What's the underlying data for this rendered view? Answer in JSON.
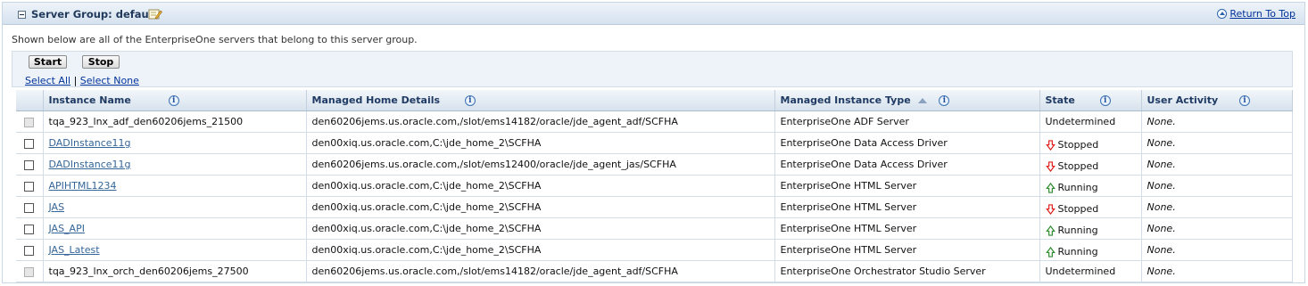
{
  "header": {
    "title": "Server Group: default",
    "return_to_top": "Return To Top"
  },
  "description": "Shown below are all of the EnterpriseOne servers that belong to this server group.",
  "toolbar": {
    "start_label": "Start",
    "stop_label": "Stop",
    "select_all": "Select All",
    "separator": "|",
    "select_none": "Select None"
  },
  "table": {
    "columns": [
      "Instance Name",
      "Managed Home Details",
      "Managed Instance Type",
      "State",
      "User Activity"
    ],
    "rows": [
      {
        "instance": "tqa_923_lnx_adf_den60206jems_21500",
        "link": false,
        "checkbox_enabled": false,
        "home": "den60206jems.us.oracle.com,/slot/ems14182/oracle/jde_agent_adf/SCFHA",
        "type": "EnterpriseOne ADF Server",
        "state": "Undetermined",
        "state_icon": "none",
        "activity": "None."
      },
      {
        "instance": "DADInstance11g",
        "link": true,
        "checkbox_enabled": true,
        "home": "den00xiq.us.oracle.com,C:\\jde_home_2\\SCFHA",
        "type": "EnterpriseOne Data Access Driver",
        "state": "Stopped",
        "state_icon": "down",
        "activity": "None."
      },
      {
        "instance": "DADInstance11g",
        "link": true,
        "checkbox_enabled": true,
        "home": "den60206jems.us.oracle.com,/slot/ems12400/oracle/jde_agent_jas/SCFHA",
        "type": "EnterpriseOne Data Access Driver",
        "state": "Stopped",
        "state_icon": "down",
        "activity": "None."
      },
      {
        "instance": "APIHTML1234",
        "link": true,
        "checkbox_enabled": true,
        "home": "den00xiq.us.oracle.com,C:\\jde_home_2\\SCFHA",
        "type": "EnterpriseOne HTML Server",
        "state": "Running",
        "state_icon": "up",
        "activity": "None."
      },
      {
        "instance": "JAS",
        "link": true,
        "checkbox_enabled": true,
        "home": "den00xiq.us.oracle.com,C:\\jde_home_2\\SCFHA",
        "type": "EnterpriseOne HTML Server",
        "state": "Stopped",
        "state_icon": "down",
        "activity": "None."
      },
      {
        "instance": "JAS_API",
        "link": true,
        "checkbox_enabled": true,
        "home": "den00xiq.us.oracle.com,C:\\jde_home_2\\SCFHA",
        "type": "EnterpriseOne HTML Server",
        "state": "Running",
        "state_icon": "up",
        "activity": "None."
      },
      {
        "instance": "JAS_Latest",
        "link": true,
        "checkbox_enabled": true,
        "home": "den00xiq.us.oracle.com,C:\\jde_home_2\\SCFHA",
        "type": "EnterpriseOne HTML Server",
        "state": "Running",
        "state_icon": "up",
        "activity": "None."
      },
      {
        "instance": "tqa_923_lnx_orch_den60206jems_27500",
        "link": false,
        "checkbox_enabled": false,
        "home": "den60206jems.us.oracle.com,/slot/ems14182/oracle/jde_agent_adf/SCFHA",
        "type": "EnterpriseOne Orchestrator Studio Server",
        "state": "Undetermined",
        "state_icon": "none",
        "activity": "None."
      }
    ]
  },
  "colors": {
    "stopped_arrow": "#e0201b",
    "running_arrow": "#2e8b2e",
    "link": "#336699"
  }
}
